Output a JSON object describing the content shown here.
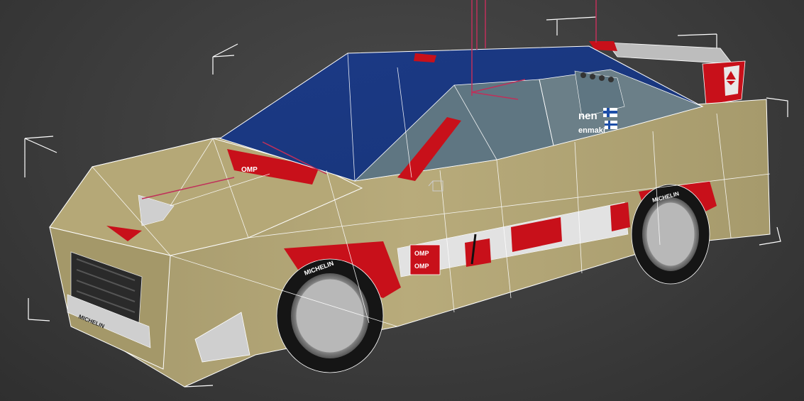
{
  "viewport": {
    "type": "3D perspective viewport",
    "display_mode": "Smooth + Highlights with Edged Faces",
    "selection": "rally car mesh (bounding box shown)"
  },
  "model": {
    "colors": {
      "body": "#b3a676",
      "roof": "#1e3f8a",
      "accent_red": "#c8101a",
      "glass": "#5f7682",
      "tire": "#151515",
      "rim": "#c9c9c9",
      "wireframe": "#ffffff",
      "gizmo": "#c0305a"
    },
    "driver_name_partial": "nen",
    "codriver_name_partial": "enmaki",
    "tire_brand": "MICHELIN",
    "windshield_badge": "OMP",
    "door_badge_top": "OMP",
    "door_badge_bottom": "OMP",
    "plate_brand": "MICHELIN",
    "flag": "finland-flag-icon"
  }
}
